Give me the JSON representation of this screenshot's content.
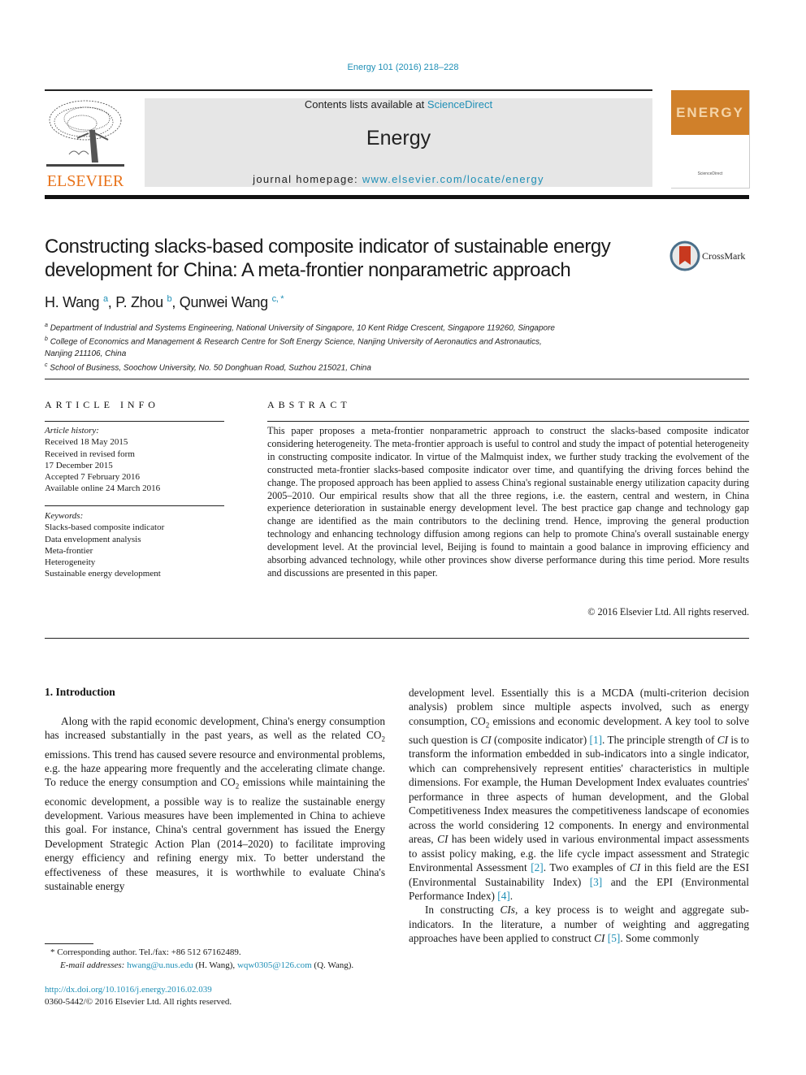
{
  "header": {
    "citation": "Energy 101 (2016) 218–228",
    "contents_prefix": "Contents lists available at ",
    "contents_link": "ScienceDirect",
    "journal_title": "Energy",
    "homepage_prefix": "journal homepage: ",
    "homepage_link": "www.elsevier.com/locate/energy",
    "publisher_logo_text": "ELSEVIER",
    "cover_title": "ENERGY",
    "cover_footer": "ScienceDirect",
    "colors": {
      "link": "#1f8fb6",
      "elsevier_orange": "#e8731b",
      "cover_orange": "#d0802a",
      "masthead_bg": "#e6e6e6"
    }
  },
  "article": {
    "title_line1": "Constructing slacks-based composite indicator of sustainable energy",
    "title_line2": "development for China: A meta-frontier nonparametric approach",
    "crossmark_label": "CrossMark",
    "authors": [
      {
        "name": "H. Wang",
        "sup": "a"
      },
      {
        "name": "P. Zhou",
        "sup": "b"
      },
      {
        "name": "Qunwei Wang",
        "sup": "c, *"
      }
    ],
    "affiliations": [
      {
        "sup": "a",
        "text": "Department of Industrial and Systems Engineering, National University of Singapore, 10 Kent Ridge Crescent, Singapore 119260, Singapore"
      },
      {
        "sup": "b",
        "text": "College of Economics and Management & Research Centre for Soft Energy Science, Nanjing University of Aeronautics and Astronautics,",
        "text2": "Nanjing 211106, China"
      },
      {
        "sup": "c",
        "text": "School of Business, Soochow University, No. 50 Donghuan Road, Suzhou 215021, China"
      }
    ]
  },
  "article_info": {
    "heading": "ARTICLE INFO",
    "history_label": "Article history:",
    "history": [
      "Received 18 May 2015",
      "Received in revised form",
      "17 December 2015",
      "Accepted 7 February 2016",
      "Available online 24 March 2016"
    ],
    "keywords_label": "Keywords:",
    "keywords": [
      "Slacks-based composite indicator",
      "Data envelopment analysis",
      "Meta-frontier",
      "Heterogeneity",
      "Sustainable energy development"
    ]
  },
  "abstract": {
    "heading": "ABSTRACT",
    "text": "This paper proposes a meta-frontier nonparametric approach to construct the slacks-based composite indicator considering heterogeneity. The meta-frontier approach is useful to control and study the impact of potential heterogeneity in constructing composite indicator. In virtue of the Malmquist index, we further study tracking the evolvement of the constructed meta-frontier slacks-based composite indicator over time, and quantifying the driving forces behind the change. The proposed approach has been applied to assess China's regional sustainable energy utilization capacity during 2005–2010. Our empirical results show that all the three regions, i.e. the eastern, central and western, in China experience deterioration in sustainable energy development level. The best practice gap change and technology gap change are identified as the main contributors to the declining trend. Hence, improving the general production technology and enhancing technology diffusion among regions can help to promote China's overall sustainable energy development level. At the provincial level, Beijing is found to maintain a good balance in improving efficiency and absorbing advanced technology, while other provinces show diverse performance during this time period. More results and discussions are presented in this paper.",
    "copyright": "© 2016 Elsevier Ltd. All rights reserved."
  },
  "body": {
    "section_heading": "1.  Introduction",
    "left": {
      "p1_a": "Along with the rapid economic development, China's energy consumption has increased substantially in the past years, as well as the related CO",
      "p1_b": " emissions. This trend has caused severe resource and environmental problems, e.g. the haze appearing more frequently and the accelerating climate change. To reduce the energy consumption and CO",
      "p1_c": " emissions while maintaining the economic development, a possible way is to realize the sustainable energy development. Various measures have been implemented in China to achieve this goal. For instance, China's central government has issued the Energy Development Strategic Action Plan (2014–2020) to facilitate improving energy efficiency and refining energy mix. To better understand the effectiveness of these measures, it is worthwhile to evaluate China's sustainable energy",
      "subscript": "2"
    },
    "right": {
      "p1_a": "development level. Essentially this is a MCDA (multi-criterion decision analysis) problem since multiple aspects involved, such as energy consumption, CO",
      "p1_b": " emissions and economic development. A key tool to solve such question is ",
      "ci": "CI",
      "p1_c": " (composite indicator) ",
      "ref1": "[1]",
      "p1_d": ". The principle strength of ",
      "p1_e": " is to transform the information embedded in sub-indicators into a single indicator, which can comprehensively represent entities' characteristics in multiple dimensions. For example, the Human Development Index evaluates countries' performance in three aspects of human development, and the Global Competitiveness Index measures the competitiveness landscape of economies across the world considering 12 components. In energy and environmental areas, ",
      "p1_f": " has been widely used in various environmental impact assessments to assist policy making, e.g. the life cycle impact assessment and Strategic Environmental Assessment ",
      "ref2": "[2]",
      "p1_g": ". Two examples of ",
      "p1_h": " in this field are the ESI (Environmental Sustainability Index) ",
      "ref3": "[3]",
      "p1_i": " and the EPI (Environmental Performance Index) ",
      "ref4": "[4]",
      "p1_j": ".",
      "p2_a": "In constructing ",
      "cis": "CIs",
      "p2_b": ", a key process is to weight and aggregate sub-indicators. In the literature, a number of weighting and aggregating approaches have been applied to construct ",
      "ref5": "[5]",
      "p2_c": ". Some commonly"
    }
  },
  "footnotes": {
    "corresponding": "*  Corresponding author. Tel./fax: +86 512 67162489.",
    "email_label": "E-mail addresses: ",
    "email1": "hwang@u.nus.edu",
    "email1_owner": " (H. Wang), ",
    "email2": "wqw0305@126.com",
    "email2_owner": " (Q. Wang).",
    "doi": "http://dx.doi.org/10.1016/j.energy.2016.02.039",
    "issn": "0360-5442/© 2016 Elsevier Ltd. All rights reserved."
  }
}
